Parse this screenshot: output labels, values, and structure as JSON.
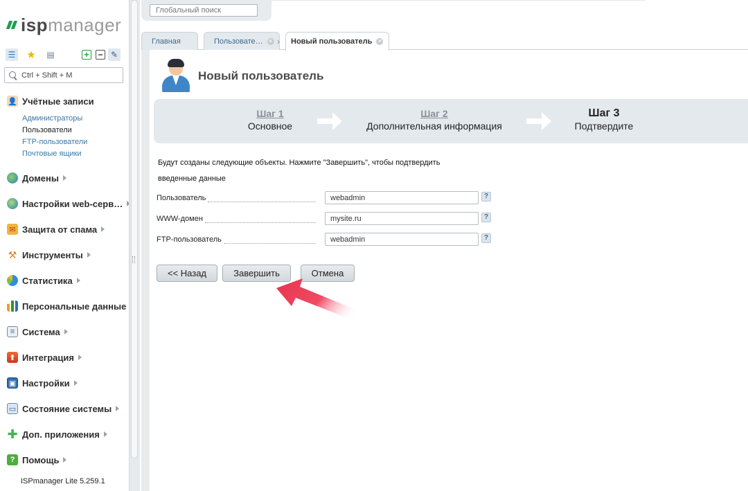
{
  "app": {
    "logo_isp": "isp",
    "logo_manager": "manager",
    "version": "ISPmanager Lite 5.259.1"
  },
  "sidebar": {
    "search_placeholder": "Ctrl + Shift + M",
    "groups": [
      {
        "label": "Учётные записи",
        "icon": "accounts-icon",
        "expanded": true,
        "items": [
          "Администраторы",
          "Пользователи",
          "FTP-пользователи",
          "Почтовые ящики"
        ]
      },
      {
        "label": "Домены",
        "icon": "domains-icon"
      },
      {
        "label": "Настройки web-серв…",
        "icon": "web-settings-icon"
      },
      {
        "label": "Защита от спама",
        "icon": "spam-protection-icon"
      },
      {
        "label": "Инструменты",
        "icon": "tools-icon"
      },
      {
        "label": "Статистика",
        "icon": "statistics-icon"
      },
      {
        "label": "Персональные данные",
        "icon": "personal-data-icon"
      },
      {
        "label": "Система",
        "icon": "system-icon"
      },
      {
        "label": "Интеграция",
        "icon": "integration-icon"
      },
      {
        "label": "Настройки",
        "icon": "settings-icon"
      },
      {
        "label": "Состояние системы",
        "icon": "system-status-icon"
      },
      {
        "label": "Доп. приложения",
        "icon": "addons-icon"
      },
      {
        "label": "Помощь",
        "icon": "help-icon"
      }
    ]
  },
  "top": {
    "global_search_placeholder": "Глобальный поиск"
  },
  "tabs": [
    {
      "label": "Главная"
    },
    {
      "label": "Пользовате…"
    },
    {
      "label": "Новый пользователь",
      "active": true
    }
  ],
  "page": {
    "title": "Новый пользователь",
    "steps": [
      {
        "label": "Шаг 1",
        "desc": "Основное"
      },
      {
        "label": "Шаг 2",
        "desc": "Дополнительная информация"
      },
      {
        "label": "Шаг 3",
        "desc": "Подтвердите",
        "current": true
      }
    ],
    "note_line1": "Будут созданы следующие объекты. Нажмите \"Завершить\", чтобы подтвердить",
    "note_line2": "введенные данные",
    "fields": [
      {
        "label": "Пользователь",
        "value": "webadmin"
      },
      {
        "label": "WWW-домен",
        "value": "mysite.ru"
      },
      {
        "label": "FTP-пользователь",
        "value": "webadmin"
      }
    ],
    "help_glyph": "?",
    "buttons": {
      "back": "<< Назад",
      "finish": "Завершить",
      "cancel": "Отмена"
    }
  },
  "colors": {
    "brand_green": "#1f9e4e",
    "link_blue": "#3a78a8",
    "panel_gray": "#e4e9ed",
    "pointer_red": "#e8354f"
  }
}
